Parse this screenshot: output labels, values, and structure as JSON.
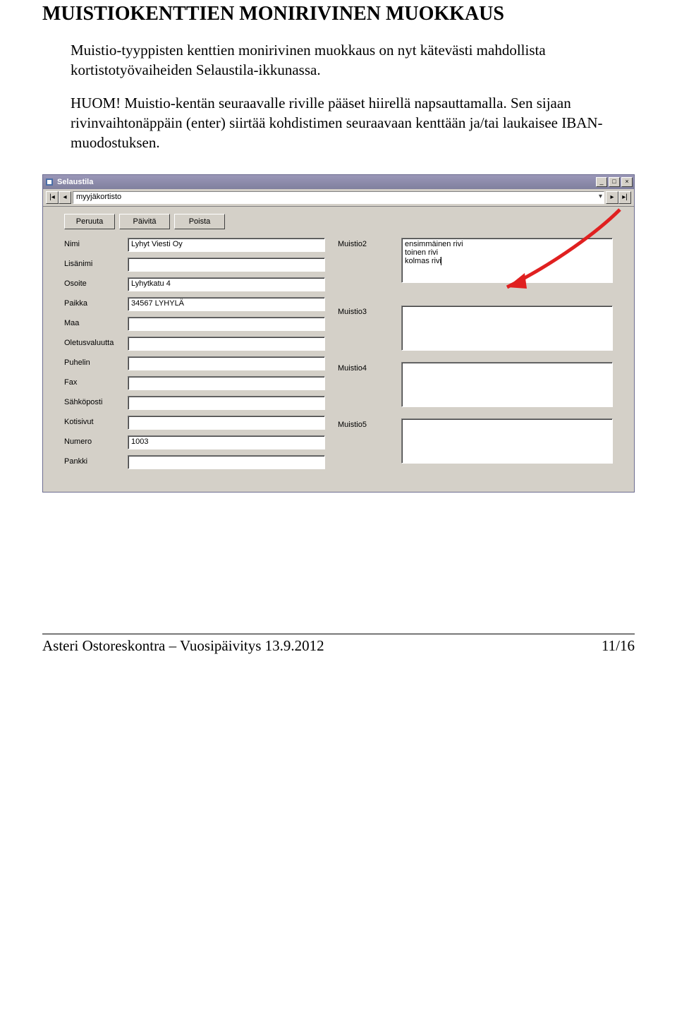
{
  "heading": "MUISTIOKENTTIEN MONIRIVINEN MUOKKAUS",
  "para1": "Muistio-tyyppisten kenttien monirivinen muokkaus on nyt kätevästi mahdollista kortistotyövaiheiden Selaustila-ikkunassa.",
  "para2": "HUOM! Muistio-kentän seuraavalle riville pääset hiirellä napsauttamalla. Sen sijaan rivinvaihtonäppäin (enter) siirtää kohdistimen seuraavaan kenttään ja/tai laukaisee IBAN-muodostuksen.",
  "window": {
    "title": "Selaustila",
    "nav_value": "myyjäkortisto",
    "buttons": {
      "cancel": "Peruuta",
      "update": "Päivitä",
      "delete": "Poista"
    },
    "left_fields": [
      {
        "label": "Nimi",
        "value": "Lyhyt Viesti Oy"
      },
      {
        "label": "Lisänimi",
        "value": ""
      },
      {
        "label": "Osoite",
        "value": "Lyhytkatu 4"
      },
      {
        "label": "Paikka",
        "value": "34567  LYHYLÄ"
      },
      {
        "label": "Maa",
        "value": ""
      },
      {
        "label": "Oletusvaluutta",
        "value": ""
      },
      {
        "label": "Puhelin",
        "value": ""
      },
      {
        "label": "Fax",
        "value": ""
      },
      {
        "label": "Sähköposti",
        "value": ""
      },
      {
        "label": "Kotisivut",
        "value": ""
      },
      {
        "label": "Numero",
        "value": "1003"
      },
      {
        "label": "Pankki",
        "value": ""
      }
    ],
    "memo_fields": [
      {
        "label": "Muistio2",
        "value": "ensimmäinen rivi\ntoinen rivi\nkolmas rivi"
      },
      {
        "label": "Muistio3",
        "value": ""
      },
      {
        "label": "Muistio4",
        "value": ""
      },
      {
        "label": "Muistio5",
        "value": ""
      }
    ]
  },
  "footer": {
    "left": "Asteri Ostoreskontra – Vuosipäivitys 13.9.2012",
    "right": "11/16"
  }
}
